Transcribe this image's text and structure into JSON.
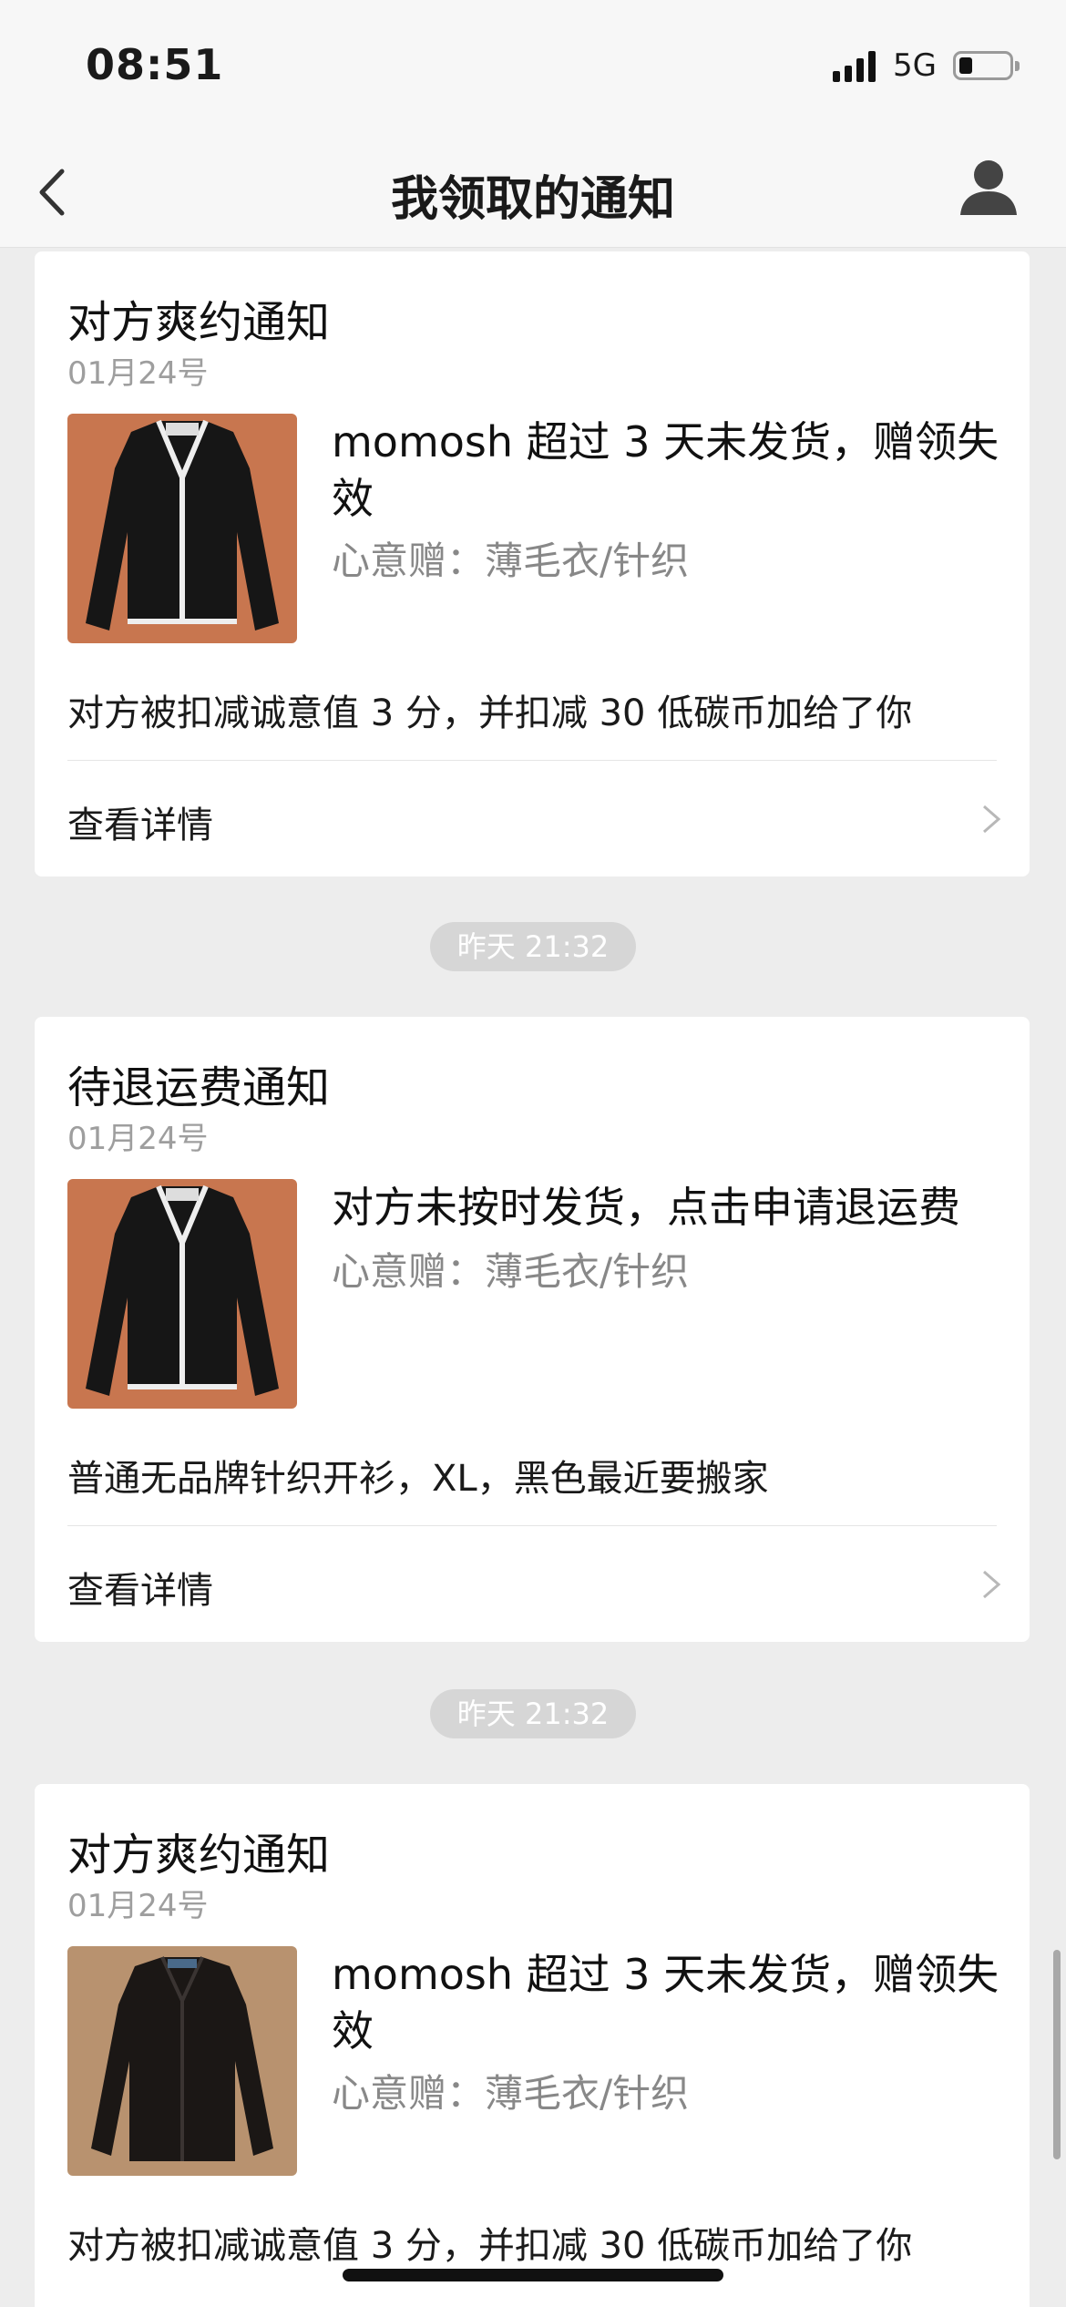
{
  "status_bar": {
    "time": "08:51",
    "network": "5G"
  },
  "nav": {
    "title": "我领取的通知"
  },
  "detail_label": "查看详情",
  "cards": [
    {
      "title": "对方爽约通知",
      "date": "01月24号",
      "notice_line1": "momosh 超过 3 天未发货，赠领失",
      "notice_line2": "效",
      "gift": "心意赠：薄毛衣/针织",
      "description": "对方被扣减诚意值 3 分，并扣减 30 低碳币加给了你"
    },
    {
      "title": "待退运费通知",
      "date": "01月24号",
      "notice_line1": "对方未按时发货，点击申请退运费",
      "gift": "心意赠：薄毛衣/针织",
      "description": "普通无品牌针织开衫，XL，黑色最近要搬家"
    },
    {
      "title": "对方爽约通知",
      "date": "01月24号",
      "notice_line1": "momosh 超过 3 天未发货，赠领失",
      "notice_line2": "效",
      "gift": "心意赠：薄毛衣/针织",
      "description": "对方被扣减诚意值 3 分，并扣减 30 低碳币加给了你"
    }
  ],
  "timestamps": [
    "昨天 21:32",
    "昨天 21:32"
  ]
}
